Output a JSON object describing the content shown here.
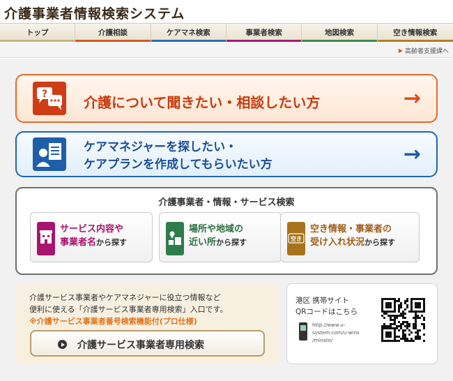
{
  "header": {
    "site_title": "介護事業者情報検索システム"
  },
  "nav": {
    "items": [
      {
        "label": "トップ",
        "color": "#c9b27e"
      },
      {
        "label": "介護相談",
        "color": "#d8581c"
      },
      {
        "label": "ケアマネ検索",
        "color": "#2c6db6"
      },
      {
        "label": "事業者検索",
        "color": "#a31b74"
      },
      {
        "label": "地図検索",
        "color": "#3a8a4c"
      },
      {
        "label": "空き情報検索",
        "color": "#b97a22"
      }
    ]
  },
  "subnav": {
    "link_label": "高齢者支援課へ"
  },
  "buttons": {
    "consult_label": "介護について聞きたい・相談したい方",
    "caremanager_line1": "ケアマネジャーを探したい・",
    "caremanager_line2": "ケアプランを作成してもらいたい方",
    "arrow": "→"
  },
  "search": {
    "title": "介護事業者・情報・サービス検索",
    "cards": [
      {
        "line1": "サービス内容や",
        "line2": "事業者名",
        "suffix": "から探す"
      },
      {
        "line1": "場所や地域の",
        "line2": "近い所",
        "suffix": "から探す"
      },
      {
        "icon_label": "空き",
        "line1": "空き情報・事業者の",
        "line2": "受け入れ状況",
        "suffix": "から探す"
      }
    ]
  },
  "pro": {
    "line1": "介護サービス事業者やケアマネジャーに役立つ情報など",
    "line2": "便利に使える「介護サービス事業者専用検索」入口です。",
    "note": "※介護サービス事業者番号検索機能付(プロ仕様)",
    "button_label": "介護サービス事業者専用検索"
  },
  "mobile": {
    "title_line1": "港区 携帯サイト",
    "title_line2": "QRコードはこちら",
    "url_line1": "http://www.u-",
    "url_line2": "system.com/u-wins",
    "url_line3": "/minato/"
  }
}
